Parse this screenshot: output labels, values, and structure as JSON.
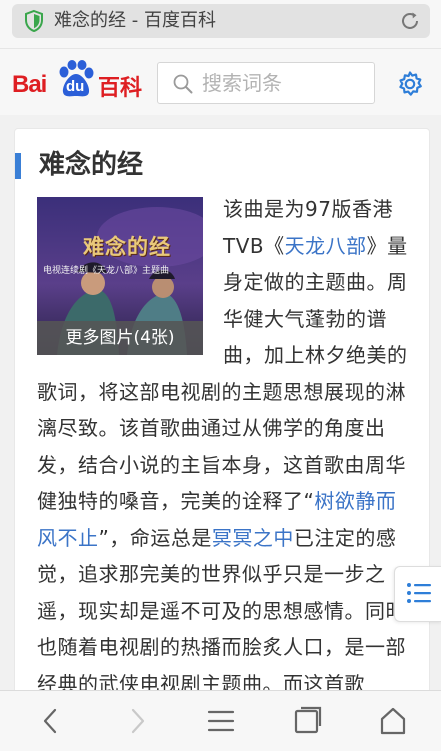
{
  "browser": {
    "tab_title": "难念的经 - 百度百科"
  },
  "header": {
    "logo_text_left": "Bai",
    "logo_text_paw": "du",
    "logo_text_right": "百科",
    "search_placeholder": "搜索词条"
  },
  "article": {
    "title": "难念的经",
    "image": {
      "caption_overlay": "难念的经",
      "subtitle_overlay": "电视连续剧《天龙八部》主题曲",
      "more_label": "更多图片(4张)"
    },
    "segments": [
      {
        "text": "该曲是为97版香港TVB《",
        "link": false
      },
      {
        "text": "天龙八部",
        "link": true
      },
      {
        "text": "》量身定做的主题曲。周华健大气蓬勃的谱曲，加上林夕绝美的歌词，将这部电视剧的主题思想展现的淋漓尽致。该首歌曲通过从佛学的角度出发，结合小说的主旨本身，这首歌由周华健独特的嗓音，完美的诠释了“",
        "link": false
      },
      {
        "text": "树欲静而风不止",
        "link": true
      },
      {
        "text": "”，命运总是",
        "link": false
      },
      {
        "text": "冥冥之中",
        "link": true
      },
      {
        "text": "已注定的感觉，追求那完美的世界似乎只是一步之遥，现实却是遥不可及的思想感情。同时也随着电视剧的热播而脍炙人口，是一部经典的武侠电视剧主题曲。而这首歌",
        "link": false
      }
    ]
  },
  "colors": {
    "brand_red": "#de1e22",
    "brand_blue": "#2b5fd8",
    "link_blue": "#3b74c7",
    "accent_bar": "#3a7fd6",
    "icon_blue": "#2e7ed8"
  },
  "icons": {
    "shield": "shield-icon",
    "reload": "reload-icon",
    "search": "search-icon",
    "settings": "gear-icon",
    "toc": "list-icon",
    "back": "back-arrow-icon",
    "forward": "forward-arrow-icon",
    "menu": "menu-icon",
    "tabs": "tabs-icon",
    "home": "home-icon"
  }
}
